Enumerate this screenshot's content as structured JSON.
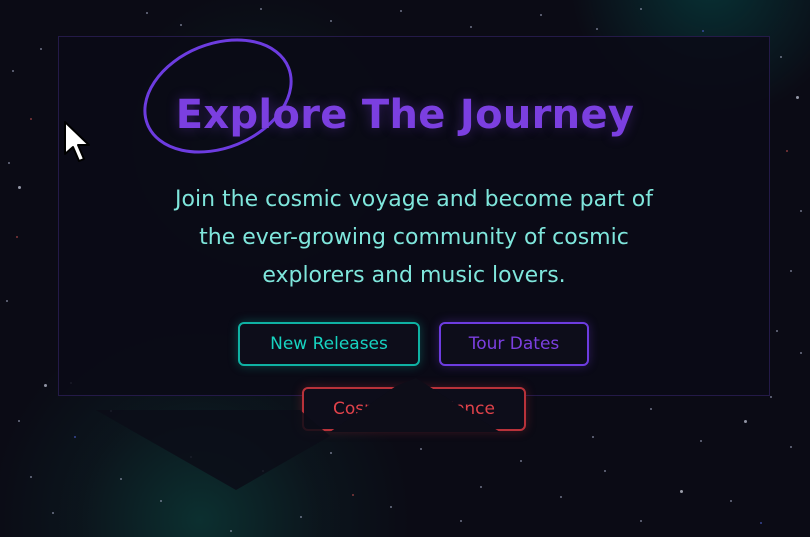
{
  "hero": {
    "title": "Explore The Journey",
    "description": "Join the cosmic voyage and become part of the ever-growing community of cosmic explorers and music lovers."
  },
  "buttons": {
    "new_releases": "New Releases",
    "tour_dates": "Tour Dates",
    "cosmic": "Cosmic Experience"
  },
  "colors": {
    "background": "#0b0b15",
    "title_purple": "#7b3fe0",
    "text_teal": "#7fe6dc",
    "button_teal": "#17d3c0",
    "button_purple": "#7b3fe0",
    "button_red": "#e0424a"
  },
  "icons": {
    "cursor": "mouse-pointer-icon",
    "orbit": "orbit-ring-icon"
  }
}
